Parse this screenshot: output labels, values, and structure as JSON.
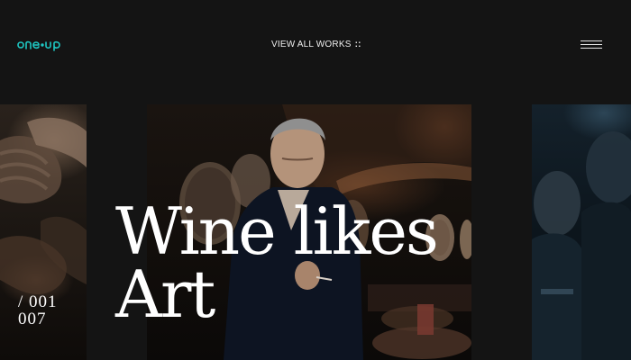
{
  "header": {
    "logo_text": "one-up",
    "view_all_label": "VIEW ALL WORKS",
    "view_all_suffix": "::",
    "menu_icon": "hamburger-icon"
  },
  "slider": {
    "counter_current": "/ 001",
    "counter_total": "007",
    "headline_line1": "Wine likes",
    "headline_line2": "Art"
  },
  "colors": {
    "background": "#141414",
    "accent": "#1ec8c4",
    "text": "#ffffff"
  }
}
